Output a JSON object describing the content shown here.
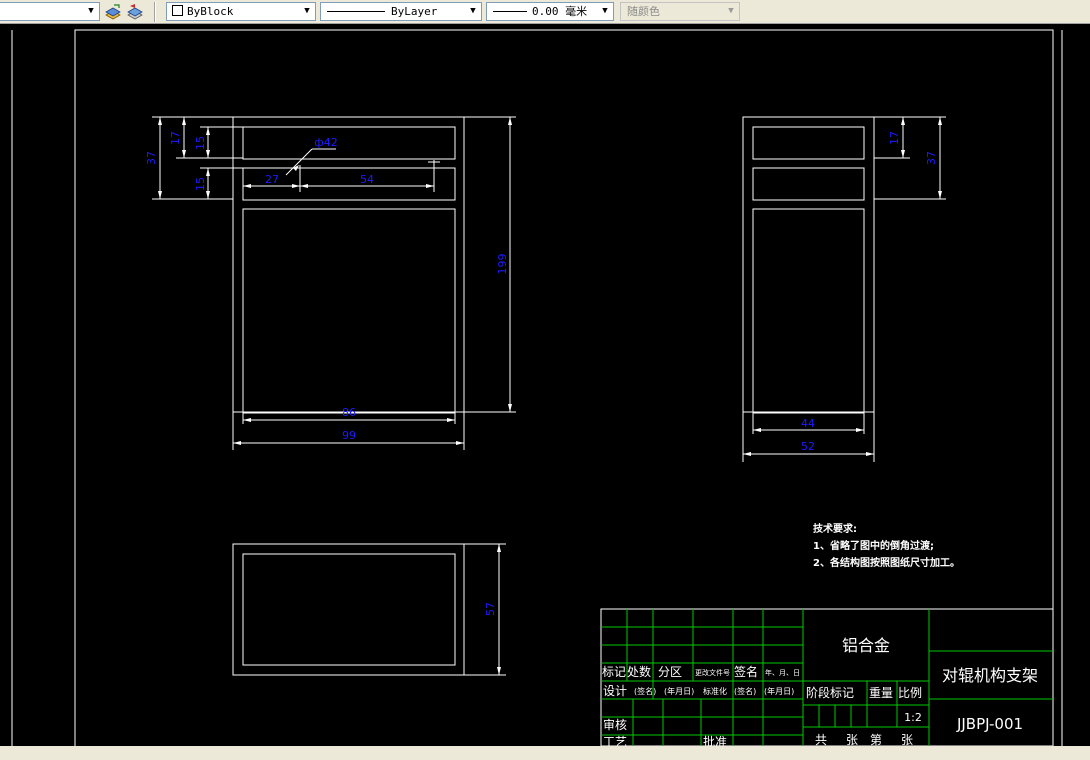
{
  "toolbar": {
    "color_value": "ByBlock",
    "linetype_value": "ByLayer",
    "lineweight_value": "0.00 毫米",
    "plotstyle_value": "随颜色"
  },
  "views": {
    "front": {
      "dims": [
        "37",
        "17",
        "15",
        "15",
        "ф42",
        "27",
        "54",
        "199",
        "86",
        "99"
      ]
    },
    "side": {
      "dims": [
        "17",
        "37",
        "44",
        "52"
      ]
    },
    "top": {
      "dims": [
        "57"
      ]
    }
  },
  "notes": {
    "title": "技术要求:",
    "lines": [
      "1、省略了图中的倒角过渡;",
      "2、各结构图按照图纸尺寸加工。"
    ]
  },
  "title_block": {
    "material": "铝合金",
    "part_name": "对辊机构支架",
    "drawing_no": "JJBPJ-001",
    "row_headers": [
      "标记",
      "处数",
      "分区",
      "更改文件号",
      "签名",
      "年、月、日"
    ],
    "design_row": [
      "设计",
      "(签名)",
      "(年月日)",
      "标准化",
      "(签名)",
      "(年月日)"
    ],
    "review": "审核",
    "process": "工艺",
    "approve": "批准",
    "stage_mark": "阶段标记",
    "weight": "重量",
    "scale_label": "比例",
    "scale_value": "1:2",
    "sheet_total": "共",
    "sheet_unit1": "张",
    "sheet_no": "第",
    "sheet_unit2": "张"
  },
  "colors": {
    "background": "#000000",
    "lines": "#ffffff",
    "dimension_text": "#1c1cff",
    "table_lines": "#00c800"
  }
}
